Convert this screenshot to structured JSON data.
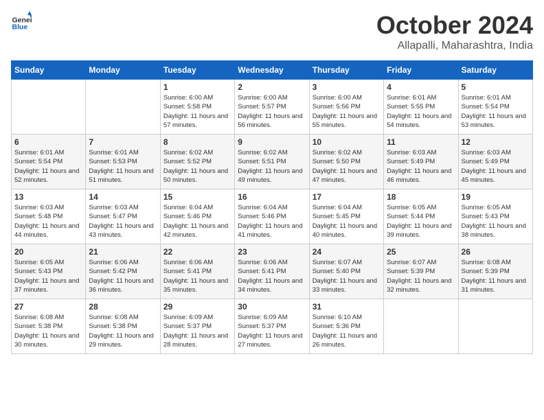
{
  "header": {
    "logo_general": "General",
    "logo_blue": "Blue",
    "month": "October 2024",
    "location": "Allapalli, Maharashtra, India"
  },
  "weekdays": [
    "Sunday",
    "Monday",
    "Tuesday",
    "Wednesday",
    "Thursday",
    "Friday",
    "Saturday"
  ],
  "weeks": [
    [
      {
        "day": "",
        "sunrise": "",
        "sunset": "",
        "daylight": ""
      },
      {
        "day": "",
        "sunrise": "",
        "sunset": "",
        "daylight": ""
      },
      {
        "day": "1",
        "sunrise": "Sunrise: 6:00 AM",
        "sunset": "Sunset: 5:58 PM",
        "daylight": "Daylight: 11 hours and 57 minutes."
      },
      {
        "day": "2",
        "sunrise": "Sunrise: 6:00 AM",
        "sunset": "Sunset: 5:57 PM",
        "daylight": "Daylight: 11 hours and 56 minutes."
      },
      {
        "day": "3",
        "sunrise": "Sunrise: 6:00 AM",
        "sunset": "Sunset: 5:56 PM",
        "daylight": "Daylight: 11 hours and 55 minutes."
      },
      {
        "day": "4",
        "sunrise": "Sunrise: 6:01 AM",
        "sunset": "Sunset: 5:55 PM",
        "daylight": "Daylight: 11 hours and 54 minutes."
      },
      {
        "day": "5",
        "sunrise": "Sunrise: 6:01 AM",
        "sunset": "Sunset: 5:54 PM",
        "daylight": "Daylight: 11 hours and 53 minutes."
      }
    ],
    [
      {
        "day": "6",
        "sunrise": "Sunrise: 6:01 AM",
        "sunset": "Sunset: 5:54 PM",
        "daylight": "Daylight: 11 hours and 52 minutes."
      },
      {
        "day": "7",
        "sunrise": "Sunrise: 6:01 AM",
        "sunset": "Sunset: 5:53 PM",
        "daylight": "Daylight: 11 hours and 51 minutes."
      },
      {
        "day": "8",
        "sunrise": "Sunrise: 6:02 AM",
        "sunset": "Sunset: 5:52 PM",
        "daylight": "Daylight: 11 hours and 50 minutes."
      },
      {
        "day": "9",
        "sunrise": "Sunrise: 6:02 AM",
        "sunset": "Sunset: 5:51 PM",
        "daylight": "Daylight: 11 hours and 49 minutes."
      },
      {
        "day": "10",
        "sunrise": "Sunrise: 6:02 AM",
        "sunset": "Sunset: 5:50 PM",
        "daylight": "Daylight: 11 hours and 47 minutes."
      },
      {
        "day": "11",
        "sunrise": "Sunrise: 6:03 AM",
        "sunset": "Sunset: 5:49 PM",
        "daylight": "Daylight: 11 hours and 46 minutes."
      },
      {
        "day": "12",
        "sunrise": "Sunrise: 6:03 AM",
        "sunset": "Sunset: 5:49 PM",
        "daylight": "Daylight: 11 hours and 45 minutes."
      }
    ],
    [
      {
        "day": "13",
        "sunrise": "Sunrise: 6:03 AM",
        "sunset": "Sunset: 5:48 PM",
        "daylight": "Daylight: 11 hours and 44 minutes."
      },
      {
        "day": "14",
        "sunrise": "Sunrise: 6:03 AM",
        "sunset": "Sunset: 5:47 PM",
        "daylight": "Daylight: 11 hours and 43 minutes."
      },
      {
        "day": "15",
        "sunrise": "Sunrise: 6:04 AM",
        "sunset": "Sunset: 5:46 PM",
        "daylight": "Daylight: 11 hours and 42 minutes."
      },
      {
        "day": "16",
        "sunrise": "Sunrise: 6:04 AM",
        "sunset": "Sunset: 5:46 PM",
        "daylight": "Daylight: 11 hours and 41 minutes."
      },
      {
        "day": "17",
        "sunrise": "Sunrise: 6:04 AM",
        "sunset": "Sunset: 5:45 PM",
        "daylight": "Daylight: 11 hours and 40 minutes."
      },
      {
        "day": "18",
        "sunrise": "Sunrise: 6:05 AM",
        "sunset": "Sunset: 5:44 PM",
        "daylight": "Daylight: 11 hours and 39 minutes."
      },
      {
        "day": "19",
        "sunrise": "Sunrise: 6:05 AM",
        "sunset": "Sunset: 5:43 PM",
        "daylight": "Daylight: 11 hours and 38 minutes."
      }
    ],
    [
      {
        "day": "20",
        "sunrise": "Sunrise: 6:05 AM",
        "sunset": "Sunset: 5:43 PM",
        "daylight": "Daylight: 11 hours and 37 minutes."
      },
      {
        "day": "21",
        "sunrise": "Sunrise: 6:06 AM",
        "sunset": "Sunset: 5:42 PM",
        "daylight": "Daylight: 11 hours and 36 minutes."
      },
      {
        "day": "22",
        "sunrise": "Sunrise: 6:06 AM",
        "sunset": "Sunset: 5:41 PM",
        "daylight": "Daylight: 11 hours and 35 minutes."
      },
      {
        "day": "23",
        "sunrise": "Sunrise: 6:06 AM",
        "sunset": "Sunset: 5:41 PM",
        "daylight": "Daylight: 11 hours and 34 minutes."
      },
      {
        "day": "24",
        "sunrise": "Sunrise: 6:07 AM",
        "sunset": "Sunset: 5:40 PM",
        "daylight": "Daylight: 11 hours and 33 minutes."
      },
      {
        "day": "25",
        "sunrise": "Sunrise: 6:07 AM",
        "sunset": "Sunset: 5:39 PM",
        "daylight": "Daylight: 11 hours and 32 minutes."
      },
      {
        "day": "26",
        "sunrise": "Sunrise: 6:08 AM",
        "sunset": "Sunset: 5:39 PM",
        "daylight": "Daylight: 11 hours and 31 minutes."
      }
    ],
    [
      {
        "day": "27",
        "sunrise": "Sunrise: 6:08 AM",
        "sunset": "Sunset: 5:38 PM",
        "daylight": "Daylight: 11 hours and 30 minutes."
      },
      {
        "day": "28",
        "sunrise": "Sunrise: 6:08 AM",
        "sunset": "Sunset: 5:38 PM",
        "daylight": "Daylight: 11 hours and 29 minutes."
      },
      {
        "day": "29",
        "sunrise": "Sunrise: 6:09 AM",
        "sunset": "Sunset: 5:37 PM",
        "daylight": "Daylight: 11 hours and 28 minutes."
      },
      {
        "day": "30",
        "sunrise": "Sunrise: 6:09 AM",
        "sunset": "Sunset: 5:37 PM",
        "daylight": "Daylight: 11 hours and 27 minutes."
      },
      {
        "day": "31",
        "sunrise": "Sunrise: 6:10 AM",
        "sunset": "Sunset: 5:36 PM",
        "daylight": "Daylight: 11 hours and 26 minutes."
      },
      {
        "day": "",
        "sunrise": "",
        "sunset": "",
        "daylight": ""
      },
      {
        "day": "",
        "sunrise": "",
        "sunset": "",
        "daylight": ""
      }
    ]
  ]
}
